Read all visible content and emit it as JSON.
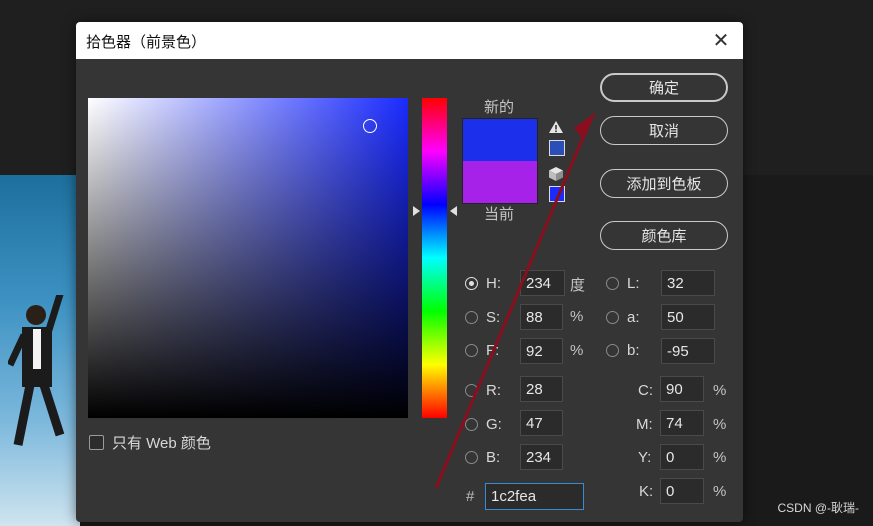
{
  "dialog": {
    "title": "拾色器（前景色）",
    "close_glyph": "✕"
  },
  "colors": {
    "new": "#1c2fea",
    "current": "#a722e8",
    "gamut_mini": "#2a4fb8",
    "web_mini": "#1a2bff"
  },
  "swatch": {
    "new_label": "新的",
    "current_label": "当前"
  },
  "buttons": {
    "ok": "确定",
    "cancel": "取消",
    "add_swatch": "添加到色板",
    "color_library": "颜色库"
  },
  "web_only": {
    "label": "只有 Web 颜色",
    "checked": false
  },
  "hsb": {
    "h": {
      "label": "H:",
      "value": "234",
      "unit": "度",
      "selected": true
    },
    "s": {
      "label": "S:",
      "value": "88",
      "unit": "%"
    },
    "b": {
      "label": "F:",
      "value": "92",
      "unit": "%"
    }
  },
  "rgb": {
    "r": {
      "label": "R:",
      "value": "28"
    },
    "g": {
      "label": "G:",
      "value": "47"
    },
    "b": {
      "label": "B:",
      "value": "234"
    }
  },
  "lab": {
    "l": {
      "label": "L:",
      "value": "32"
    },
    "a": {
      "label": "a:",
      "value": "50"
    },
    "b": {
      "label": "b:",
      "value": "-95"
    }
  },
  "cmyk": {
    "c": {
      "label": "C:",
      "value": "90",
      "unit": "%"
    },
    "m": {
      "label": "M:",
      "value": "74",
      "unit": "%"
    },
    "y": {
      "label": "Y:",
      "value": "0",
      "unit": "%"
    },
    "k": {
      "label": "K:",
      "value": "0",
      "unit": "%"
    }
  },
  "hex": {
    "prefix": "#",
    "value": "1c2fea"
  },
  "watermark": "CSDN @-耿瑞-"
}
